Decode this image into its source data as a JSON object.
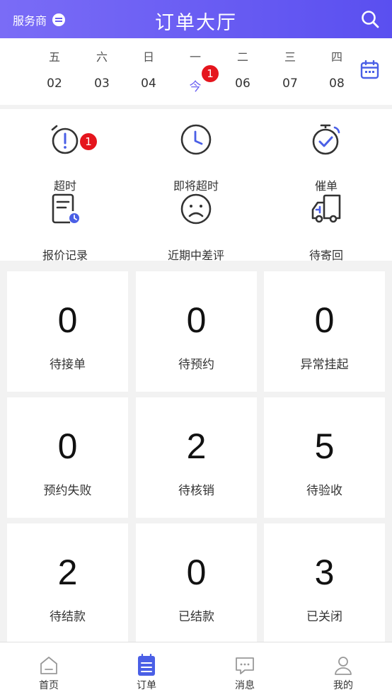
{
  "header": {
    "provider_label": "服务商",
    "title": "订单大厅",
    "accent_color": "#6a5ff2"
  },
  "calendar": {
    "days": [
      {
        "weekday": "五",
        "date": "02"
      },
      {
        "weekday": "六",
        "date": "03"
      },
      {
        "weekday": "日",
        "date": "04"
      },
      {
        "weekday": "一",
        "date": "今",
        "badge": "1"
      },
      {
        "weekday": "二",
        "date": "06"
      },
      {
        "weekday": "三",
        "date": "07"
      },
      {
        "weekday": "四",
        "date": "08"
      }
    ],
    "icon": "calendar-icon"
  },
  "quick_actions": [
    {
      "label": "超时",
      "icon": "alarm-icon",
      "badge": "1"
    },
    {
      "label": "即将超时",
      "icon": "clock-icon"
    },
    {
      "label": "催单",
      "icon": "stopwatch-check-icon"
    },
    {
      "label": "报价记录",
      "icon": "quote-record-icon"
    },
    {
      "label": "近期中差评",
      "icon": "sad-face-icon"
    },
    {
      "label": "待寄回",
      "icon": "truck-icon"
    }
  ],
  "stats": [
    {
      "value": "0",
      "label": "待接单"
    },
    {
      "value": "0",
      "label": "待预约"
    },
    {
      "value": "0",
      "label": "异常挂起"
    },
    {
      "value": "0",
      "label": "预约失败"
    },
    {
      "value": "2",
      "label": "待核销"
    },
    {
      "value": "5",
      "label": "待验收"
    },
    {
      "value": "2",
      "label": "待结款"
    },
    {
      "value": "0",
      "label": "已结款"
    },
    {
      "value": "3",
      "label": "已关闭"
    }
  ],
  "tabbar": {
    "items": [
      {
        "label": "首页",
        "icon": "home-icon"
      },
      {
        "label": "订单",
        "icon": "order-icon",
        "active": true
      },
      {
        "label": "消息",
        "icon": "message-icon"
      },
      {
        "label": "我的",
        "icon": "user-icon"
      }
    ]
  }
}
